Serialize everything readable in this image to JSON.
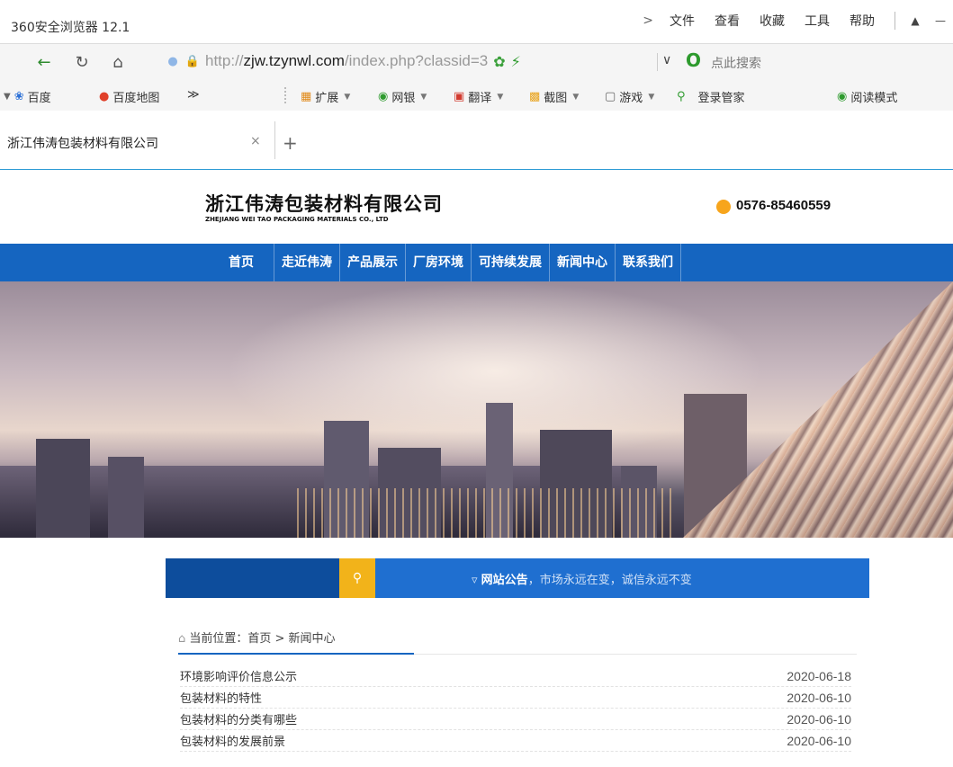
{
  "browser": {
    "window_title": "360安全浏览器 12.1",
    "menu": {
      "chevron": ">",
      "items": [
        "文件",
        "查看",
        "收藏",
        "工具",
        "帮助"
      ]
    },
    "address": {
      "scheme": "http://",
      "domain": "zjw.tzynwl.com",
      "path": "/index.php?classid=3"
    },
    "search_hint": "点此搜索",
    "bookmarks": [
      "百度",
      "百度地图",
      "≫"
    ],
    "toolbar_items": [
      "扩展",
      "网银",
      "翻译",
      "截图",
      "游戏",
      "登录管家",
      "阅读模式"
    ],
    "tab": {
      "title": "浙江伟涛包装材料有限公司",
      "close": "×",
      "add": "+"
    }
  },
  "site": {
    "company_cn": "浙江伟涛包装材料有限公司",
    "company_en": "ZHEJIANG WEI TAO PACKAGING MATERIALS CO., LTD",
    "phone": "0576-85460559",
    "nav": [
      "首页",
      "走近伟涛",
      "产品展示",
      "厂房环境",
      "可持续发展",
      "新闻中心",
      "联系我们"
    ],
    "notice": {
      "label": "网站公告",
      "text": "，市场永远在变，诚信永远不变"
    },
    "breadcrumb": "当前位置：首页 > 新闻中心",
    "news": [
      {
        "title": "环境影响评价信息公示",
        "date": "2020-06-18"
      },
      {
        "title": "包装材料的特性",
        "date": "2020-06-10"
      },
      {
        "title": "包装材料的分类有哪些",
        "date": "2020-06-10"
      },
      {
        "title": "包装材料的发展前景",
        "date": "2020-06-10"
      }
    ]
  },
  "colors": {
    "nav_bg": "#1565c0",
    "notice_bg": "#1f6fd0",
    "search_btn": "#f2b31a",
    "phone_icon": "#f7a51c"
  },
  "icons": [
    "back-arrow-icon",
    "refresh-icon",
    "home-icon",
    "lock-icon",
    "shield-icon",
    "speed-icon",
    "search-logo-icon",
    "paw-icon",
    "map-pin-icon",
    "grid-icon",
    "megaphone-icon",
    "magnifier-icon"
  ]
}
